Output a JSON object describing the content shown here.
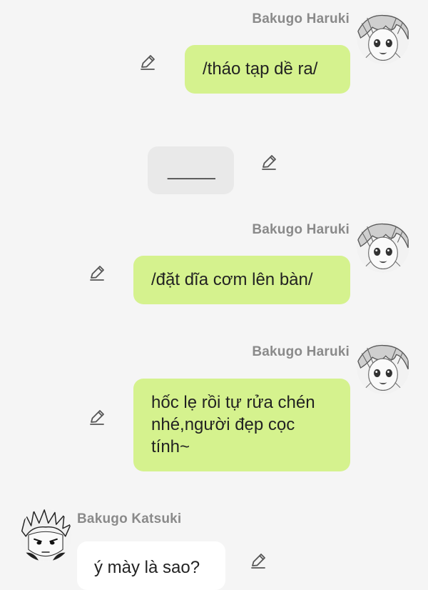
{
  "messages": [
    {
      "sender": "Bakugo Haruki",
      "text": "/tháo tạp dề ra/",
      "avatar_icon": "anime-avatar-haruki-icon"
    },
    {
      "text": "_____",
      "edit_icon": "pencil-icon"
    },
    {
      "sender": "Bakugo Haruki",
      "text": "/đặt dĩa cơm lên bàn/",
      "avatar_icon": "anime-avatar-haruki-icon"
    },
    {
      "sender": "Bakugo Haruki",
      "text": "hốc lẹ rồi tự rửa chén nhé,người đẹp cọc tính~",
      "avatar_icon": "anime-avatar-haruki-icon"
    },
    {
      "sender": "Bakugo Katsuki",
      "text": "ý mày là sao?",
      "avatar_icon": "anime-avatar-katsuki-icon"
    }
  ],
  "colors": {
    "sent_bubble": "#d5f28e",
    "system_bubble": "#e9e9e9",
    "received_bubble": "#ffffff",
    "background": "#f5f5f5",
    "name_text": "#8a8a8a"
  }
}
